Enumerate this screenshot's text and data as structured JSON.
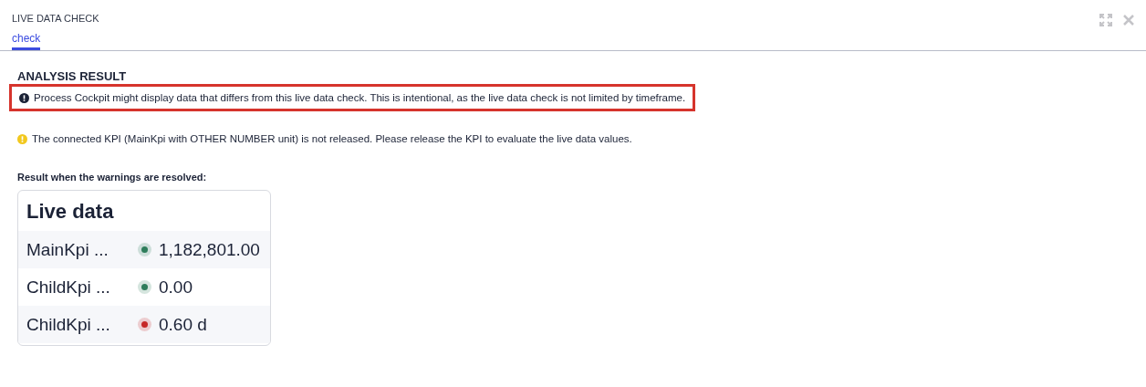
{
  "window": {
    "title": "LIVE DATA CHECK"
  },
  "tabs": [
    {
      "label": "check",
      "selected": true
    }
  ],
  "section_title": "ANALYSIS RESULT",
  "notices": [
    {
      "kind": "info",
      "text": "Process Cockpit might display data that differs from this live data check. This is intentional, as the live data check is not limited by timeframe.",
      "highlighted": true
    },
    {
      "kind": "warning",
      "text": "The connected KPI (MainKpi with OTHER NUMBER unit) is not released. Please release the KPI to evaluate the live data values.",
      "highlighted": false
    }
  ],
  "result_label": "Result when the warnings are resolved:",
  "card": {
    "title": "Live data",
    "rows": [
      {
        "name": "MainKpi ...",
        "value": "1,182,801.00",
        "color": "#2e7d5b"
      },
      {
        "name": "ChildKpi ...",
        "value": "0.00",
        "color": "#2e7d5b"
      },
      {
        "name": "ChildKpi ...",
        "value": "0.60 d",
        "color": "#c62828"
      }
    ]
  }
}
